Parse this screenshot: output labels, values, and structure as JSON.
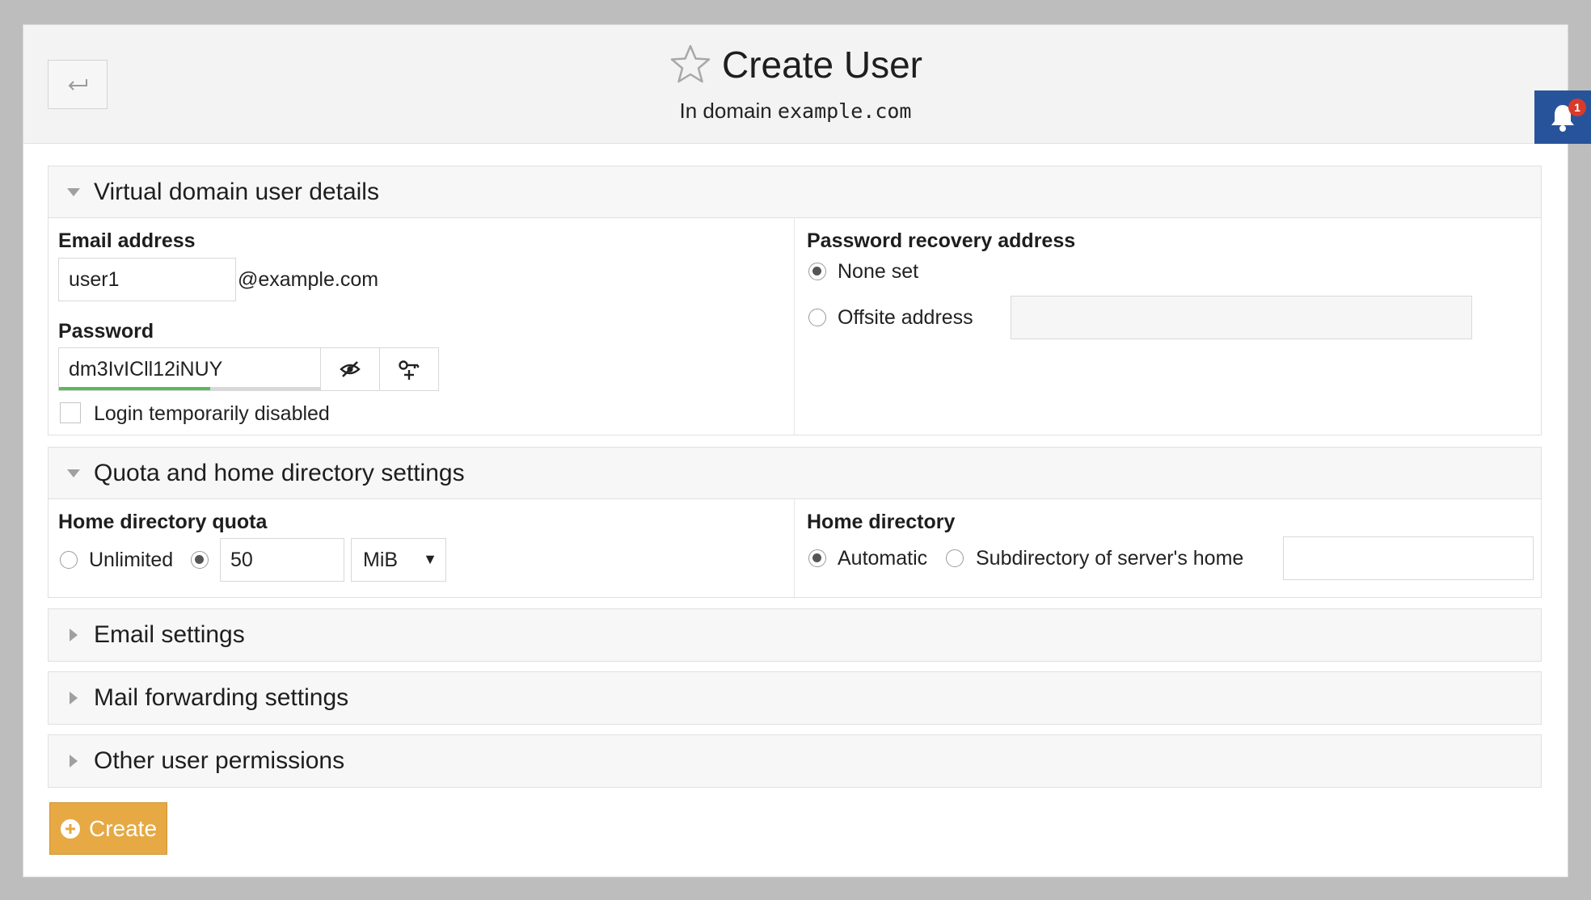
{
  "header": {
    "title": "Create User",
    "subtitle_prefix": "In domain",
    "subtitle_domain": "example.com"
  },
  "notifications": {
    "count": "1"
  },
  "sections": {
    "details": {
      "title": "Virtual domain user details",
      "email_label": "Email address",
      "email_value": "user1",
      "email_suffix": "@example.com",
      "password_label": "Password",
      "password_value": "dm3IvICll12iNUY",
      "password_strength": 0.58,
      "login_disabled_label": "Login temporarily disabled",
      "recovery_label": "Password recovery address",
      "recovery_none": "None set",
      "recovery_offsite": "Offsite address",
      "recovery_offsite_value": ""
    },
    "quota": {
      "title": "Quota and home directory settings",
      "quota_label": "Home directory quota",
      "unlimited_label": "Unlimited",
      "quota_value": "50",
      "quota_unit": "MiB",
      "home_label": "Home directory",
      "home_auto": "Automatic",
      "home_subdir": "Subdirectory of server's home",
      "home_subdir_value": ""
    },
    "email": {
      "title": "Email settings"
    },
    "forwarding": {
      "title": "Mail forwarding settings"
    },
    "permissions": {
      "title": "Other user permissions"
    }
  },
  "actions": {
    "create_label": "Create"
  },
  "colors": {
    "accent_button": "#e6a943",
    "notification": "#27539b",
    "badge": "#d93a2b",
    "strength": "#5cb85c"
  }
}
